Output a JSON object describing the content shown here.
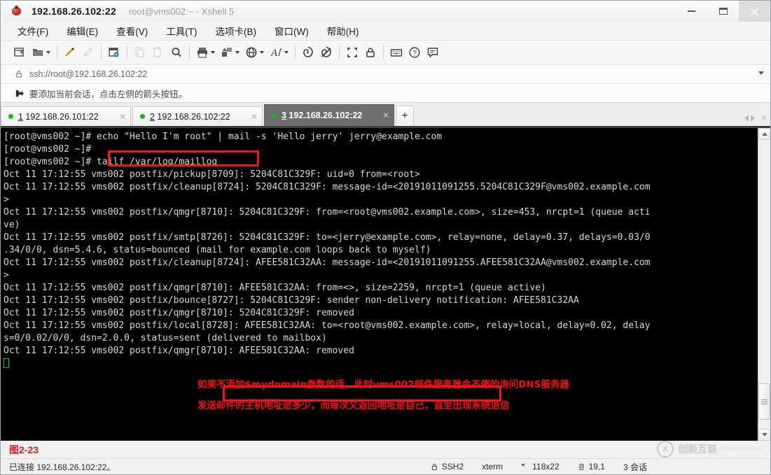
{
  "window": {
    "title": "192.168.26.102:22",
    "subtitle": "root@vms002:~ - Xshell 5",
    "app_icon": "xshell-bug-icon",
    "controls": {
      "minimize": "minimize-icon",
      "maximize": "maximize-icon",
      "close": "close-icon"
    }
  },
  "menu": [
    {
      "label": "文件(F)",
      "name": "menu-file"
    },
    {
      "label": "编辑(E)",
      "name": "menu-edit"
    },
    {
      "label": "查看(V)",
      "name": "menu-view"
    },
    {
      "label": "工具(T)",
      "name": "menu-tools"
    },
    {
      "label": "选项卡(B)",
      "name": "menu-tabs"
    },
    {
      "label": "窗口(W)",
      "name": "menu-window"
    },
    {
      "label": "帮助(H)",
      "name": "menu-help"
    }
  ],
  "toolbar": {
    "items": [
      {
        "name": "new-session-icon",
        "tip": "新建"
      },
      {
        "name": "open-folder-icon",
        "tip": "打开"
      },
      {
        "name": "paint-brush-icon",
        "tip": "会话颜色"
      },
      {
        "name": "pencil-icon",
        "tip": "编辑"
      },
      {
        "name": "session-properties-icon",
        "tip": "属性"
      },
      {
        "name": "copy-icon",
        "tip": "复制"
      },
      {
        "name": "paste-icon",
        "tip": "粘贴"
      },
      {
        "name": "find-icon",
        "tip": "查找"
      },
      {
        "name": "print-icon",
        "tip": "打印"
      },
      {
        "name": "transfer-file-icon",
        "tip": "文件传输"
      },
      {
        "name": "globe-icon",
        "tip": "编码"
      },
      {
        "name": "font-icon",
        "tip": "字体"
      },
      {
        "name": "script-run-icon",
        "tip": "运行脚本"
      },
      {
        "name": "script-stop-icon",
        "tip": "停止脚本"
      },
      {
        "name": "fullscreen-icon",
        "tip": "全屏"
      },
      {
        "name": "lock-icon",
        "tip": "锁定"
      },
      {
        "name": "keyboard-icon",
        "tip": "键盘"
      },
      {
        "name": "help-icon",
        "tip": "帮助"
      },
      {
        "name": "feedback-icon",
        "tip": "反馈"
      }
    ]
  },
  "address_bar": {
    "icon": "lock-icon",
    "value": "ssh://root@192.168.26.102:22",
    "dropdown_icon": "chevron-down-icon"
  },
  "info_bar": {
    "icon": "add-session-icon",
    "text": "要添加当前会话，点击左侧的箭头按钮。"
  },
  "tabs": {
    "items": [
      {
        "num": "1",
        "label": " 192.168.26.101:22",
        "active": false,
        "status": "connected"
      },
      {
        "num": "2",
        "label": " 192.168.26.102:22",
        "active": false,
        "status": "connected"
      },
      {
        "num": "3",
        "label": " 192.168.26.102:22",
        "active": true,
        "status": "connected"
      }
    ],
    "add_label": "+",
    "nav_left": "chevron-left-icon",
    "nav_right": "chevron-right-icon",
    "nav_close": "close-icon"
  },
  "terminal": {
    "lines": [
      "[root@vms002 ~]# echo \"Hello I'm root\" | mail -s 'Hello jerry' jerry@example.com",
      "[root@vms002 ~]#",
      "[root@vms002 ~]# tailf /var/log/maillog",
      "Oct 11 17:12:55 vms002 postfix/pickup[8709]: 5204C81C329F: uid=0 from=<root>",
      "Oct 11 17:12:55 vms002 postfix/cleanup[8724]: 5204C81C329F: message-id=<20191011091255.5204C81C329F@vms002.example.com",
      ">",
      "Oct 11 17:12:55 vms002 postfix/qmgr[8710]: 5204C81C329F: from=<root@vms002.example.com>, size=453, nrcpt=1 (queue acti",
      "ve)",
      "Oct 11 17:12:55 vms002 postfix/smtp[8726]: 5204C81C329F: to=<jerry@example.com>, relay=none, delay=0.37, delays=0.03/0",
      ".34/0/0, dsn=5.4.6, status=bounced (mail for example.com loops back to myself)",
      "Oct 11 17:12:55 vms002 postfix/cleanup[8724]: AFEE581C32AA: message-id=<20191011091255.AFEE581C32AA@vms002.example.com",
      ">",
      "Oct 11 17:12:55 vms002 postfix/qmgr[8710]: AFEE581C32AA: from=<>, size=2259, nrcpt=1 (queue active)",
      "Oct 11 17:12:55 vms002 postfix/bounce[8727]: 5204C81C329F: sender non-delivery notification: AFEE581C32AA",
      "Oct 11 17:12:55 vms002 postfix/qmgr[8710]: 5204C81C329F: removed",
      "Oct 11 17:12:55 vms002 postfix/local[8728]: AFEE581C32AA: to=<root@vms002.example.com>, relay=local, delay=0.02, delay",
      "s=0/0.02/0/0, dsn=2.0.0, status=sent (delivered to mailbox)",
      "Oct 11 17:12:55 vms002 postfix/qmgr[8710]: AFEE581C32AA: removed"
    ],
    "highlights": [
      {
        "name": "highlight-tailf-command",
        "text": "tailf /var/log/maillog"
      },
      {
        "name": "highlight-loops-back",
        "text": "(mail for example.com loops back to myself)"
      }
    ],
    "annotations": [
      "如果不添加$mydomain参数的话，此时vms002邮件服务器会不停的询问DNS服务器",
      "发送邮件的主机地址是多少，而每次又返回地址是自己，直至出现系统退信"
    ],
    "accent_red": "#f51010",
    "background": "#000000",
    "foreground": "#d8d8d8",
    "cursor_color": "#25c225"
  },
  "caption": {
    "text": "图2-23",
    "color": "#d81f26"
  },
  "watermark": {
    "mark": "X",
    "text": "创新互联",
    "subtext": "CHUANG XIN HU LIAN"
  },
  "statusbar": {
    "connection": "已连接 192.168.26.102:22。",
    "protocol": "SSH2",
    "terminal_type": "xterm",
    "size": "118x22",
    "cursor_pos": "19,1",
    "sessions": "3 会话",
    "lock_icon": "lock-icon",
    "size_icon": "resize-icon",
    "pos_icon": "cursor-position-icon"
  }
}
